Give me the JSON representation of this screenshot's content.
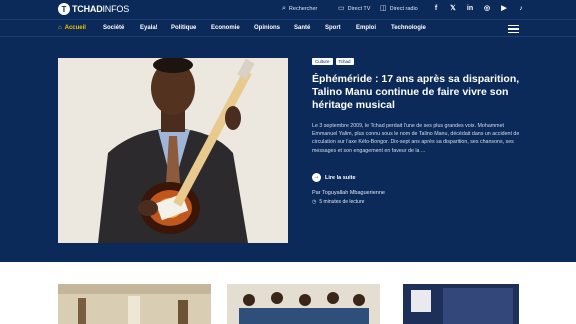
{
  "brand": {
    "mark": "T",
    "name_bold": "TCHAD",
    "name_light": "INFOS"
  },
  "utilities": [
    {
      "icon": "search-icon",
      "label": "Rechercher"
    },
    {
      "icon": "tv-icon",
      "label": "Direct TV"
    },
    {
      "icon": "radio-icon",
      "label": "Direct radio"
    }
  ],
  "socials": [
    {
      "icon": "facebook-icon",
      "glyph": "f"
    },
    {
      "icon": "x-icon",
      "glyph": "𝕏"
    },
    {
      "icon": "linkedin-icon",
      "glyph": "in"
    },
    {
      "icon": "instagram-icon",
      "glyph": "◎"
    },
    {
      "icon": "youtube-icon",
      "glyph": "▶"
    },
    {
      "icon": "tiktok-icon",
      "glyph": "♪"
    }
  ],
  "nav": {
    "home": "Accueil",
    "items": [
      "Société",
      "Eyala!",
      "Politique",
      "Economie",
      "Opinions",
      "Santé",
      "Sport",
      "Emploi",
      "Technologie"
    ]
  },
  "hero": {
    "tags": [
      "Culture",
      "Tchad"
    ],
    "title": "Éphéméride : 17 ans après sa disparition, Talino Manu continue de faire vivre son héritage musical",
    "excerpt": "Le 3 septembre 2009, le Tchad perdait l'une de ses plus grandes voix. Mohammet Emmanuel Yalim, plus connu sous le nom de Talino Manu, décédait dans un accident de circulation sur l'axe Kélo-Bongor. Dix-sept ans après sa disparition, ses chansons, ses messages et son engagement en faveur de la ...",
    "read_more": "Lire la suite",
    "author": "Par Toguyallah Mbaguerienne",
    "read_time": "5 minutes de lecture"
  },
  "colors": {
    "navy": "#0b2a5a",
    "accent": "#f2c200",
    "lower_bg": "#ffffff"
  }
}
